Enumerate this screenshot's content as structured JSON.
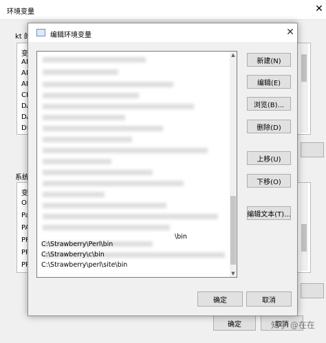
{
  "outer_window": {
    "title": "环境变量",
    "user_label": "kt 的",
    "system_label": "系统",
    "user_rows": [
      "变",
      "AN",
      "AN",
      "AP",
      "CL",
      "DA",
      "DA",
      "DI"
    ],
    "system_rows": [
      "变",
      "Ol",
      "Pa",
      "PA",
      "PR",
      "PR",
      "PR"
    ],
    "ok_label": "确定",
    "cancel_label": "取消"
  },
  "dialog": {
    "title": "编辑环境变量",
    "paths": [
      "C:\\Strawberry\\Perl\\bin",
      "C:\\Strawberry\\c\\bin",
      "C:\\Strawberry\\perl\\site\\bin"
    ],
    "partial_path_fragment": "\\bin",
    "buttons": {
      "new": "新建(N)",
      "edit": "编辑(E)",
      "browse": "浏览(B)...",
      "delete": "删除(D)",
      "move_up": "上移(U)",
      "move_down": "下移(O)",
      "edit_text": "编辑文本(T)...",
      "ok": "确定",
      "cancel": "取消"
    }
  },
  "watermark": "知乎 @在在"
}
